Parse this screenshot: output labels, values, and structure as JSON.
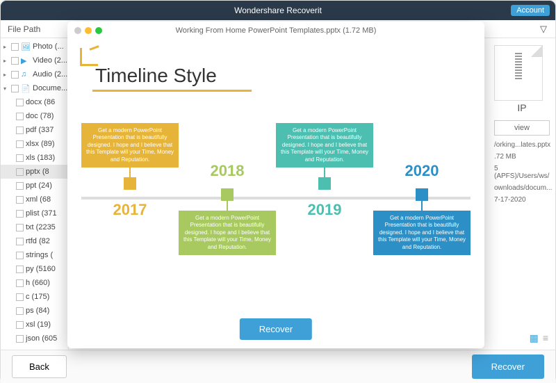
{
  "app": {
    "title": "Wondershare Recoverit",
    "account_btn": "Account"
  },
  "subbar": {
    "label": "File Path"
  },
  "sidebar": {
    "categories": [
      {
        "label": "Photo (...",
        "icon": "🖼"
      },
      {
        "label": "Video (2...",
        "icon": "▶"
      },
      {
        "label": "Audio (2...",
        "icon": "♫"
      },
      {
        "label": "Docume...",
        "icon": "📄",
        "expanded": true
      }
    ],
    "docs": [
      {
        "label": "docx (86"
      },
      {
        "label": "doc (78)"
      },
      {
        "label": "pdf (337"
      },
      {
        "label": "xlsx (89)"
      },
      {
        "label": "xls (183)"
      },
      {
        "label": "pptx (8",
        "selected": true
      },
      {
        "label": "ppt (24)"
      },
      {
        "label": "xml (68"
      },
      {
        "label": "plist (371"
      },
      {
        "label": "txt (2235"
      },
      {
        "label": "rtfd (82"
      },
      {
        "label": "strings ("
      },
      {
        "label": "py (5160"
      },
      {
        "label": "h (660)"
      },
      {
        "label": "c (175)"
      },
      {
        "label": "ps (84)"
      },
      {
        "label": "xsl (19)"
      },
      {
        "label": "json (605"
      }
    ]
  },
  "right_panel": {
    "zip_label": "IP",
    "preview_btn": "view",
    "filename": "/orking...lates.pptx",
    "size": ".72 MB",
    "path": "5 (APFS)/Users/ws/",
    "path2": "ownloads/docum...",
    "date": "7-17-2020"
  },
  "footer": {
    "back": "Back",
    "recover": "Recover"
  },
  "preview": {
    "filename": "Working From Home PowerPoint Templates.pptx (1.72 MB)",
    "slide_title": "Timeline Style",
    "box_text": "Get a modern PowerPoint Presentation that is beautifully designed. I hope and I believe that this Template will your Time, Money and Reputation.",
    "years": [
      "2017",
      "2018",
      "2019",
      "2020"
    ],
    "recover_btn": "Recover"
  }
}
